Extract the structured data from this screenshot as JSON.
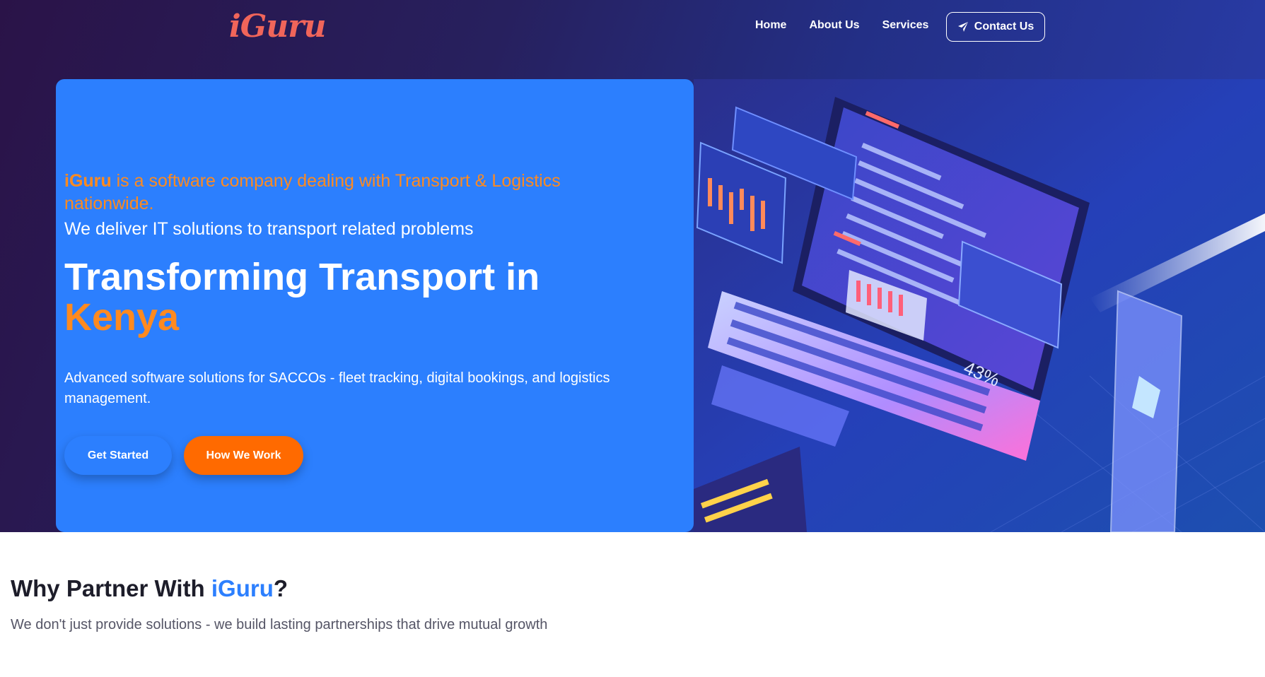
{
  "brand": {
    "logo": "iGuru",
    "accent_color": "#2c7ffe",
    "orange": "#ff8a1f",
    "logo_color": "#f0655a"
  },
  "nav": {
    "links": [
      "Home",
      "About Us",
      "Services"
    ],
    "contact_label": "Contact Us",
    "contact_icon": "paper-plane-icon"
  },
  "hero": {
    "intro_brand": "iGuru",
    "intro_rest": " is a software company dealing with Transport & Logistics nationwide.",
    "deliver": "We deliver IT solutions to transport related problems",
    "headline_line1": "Transforming Transport in",
    "headline_accent": "Kenya",
    "description": "Advanced software solutions for SACCOs - fleet tracking, digital bookings, and logistics management.",
    "btn_start": "Get Started",
    "btn_how": "How We Work",
    "illustration_badge": "43%"
  },
  "partner": {
    "title_prefix": "Why Partner With ",
    "title_brand": "iGuru",
    "title_suffix": "?",
    "subtitle": "We don't just provide solutions - we build lasting partnerships that drive mutual growth"
  }
}
